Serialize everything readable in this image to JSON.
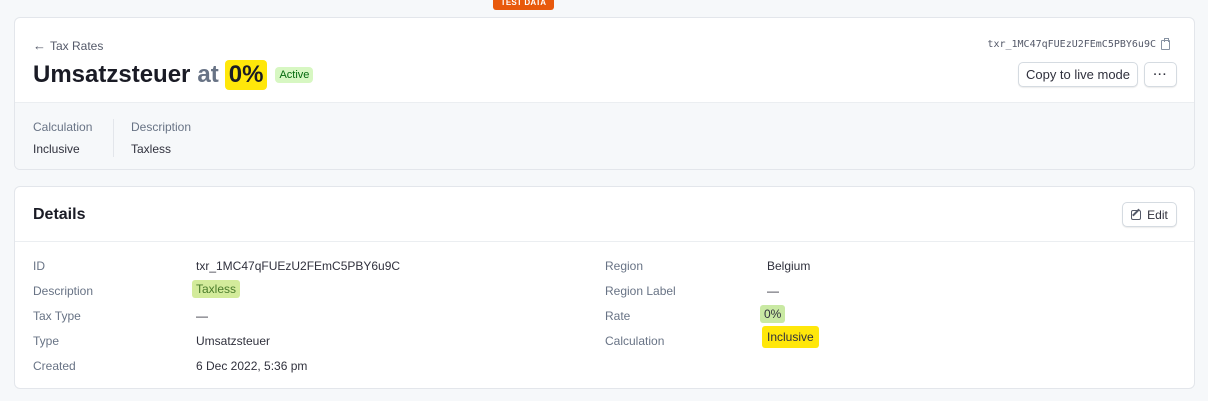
{
  "badge": "TEST DATA",
  "header": {
    "back_label": "Tax Rates",
    "title_name": "Umsatzsteuer",
    "title_at": "at",
    "title_rate": "0%",
    "status": "Active",
    "tax_rate_id": "txr_1MC47qFUEzU2FEmC5PBY6u9C",
    "copy_live_label": "Copy to live mode",
    "more_label": "···"
  },
  "summary": [
    {
      "label": "Calculation",
      "value": "Inclusive"
    },
    {
      "label": "Description",
      "value": "Taxless"
    }
  ],
  "details": {
    "title": "Details",
    "edit_label": "Edit",
    "left": [
      {
        "label": "ID",
        "value": "txr_1MC47qFUEzU2FEmC5PBY6u9C"
      },
      {
        "label": "Description",
        "value": "Taxless"
      },
      {
        "label": "Tax Type",
        "value": "—"
      },
      {
        "label": "Type",
        "value": "Umsatzsteuer"
      },
      {
        "label": "Created",
        "value": "6 Dec 2022, 5:36 pm"
      }
    ],
    "right": [
      {
        "label": "Region",
        "value": "Belgium"
      },
      {
        "label": "Region Label",
        "value": "—"
      },
      {
        "label": "Rate",
        "value": "0%"
      },
      {
        "label": "Calculation",
        "value": "Inclusive"
      }
    ]
  },
  "colors": {
    "highlight_yellow": "#ffe70a",
    "highlight_green": "#c9e9a3",
    "status_green": "#d7f7c2",
    "test_badge": "#e8590c"
  },
  "icons": [
    "arrow-left-icon",
    "copy-icon",
    "edit-icon",
    "more-icon"
  ]
}
